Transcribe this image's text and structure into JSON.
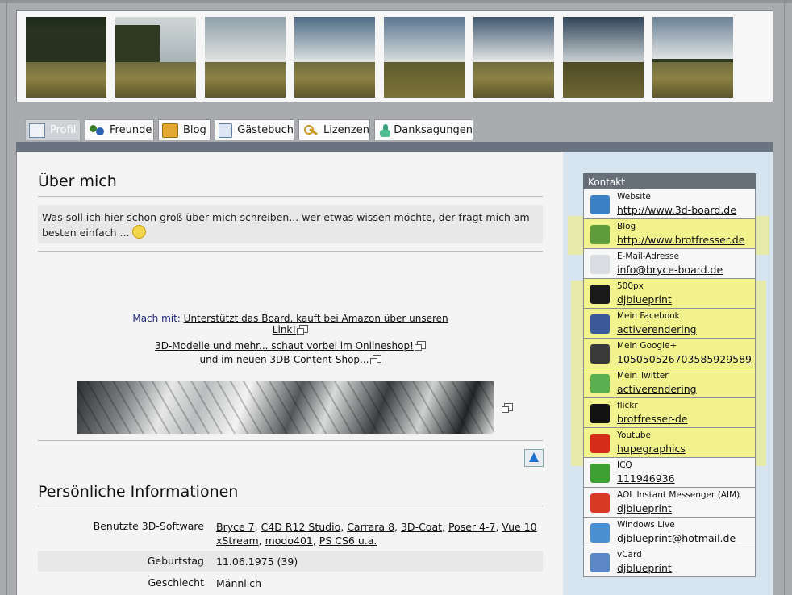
{
  "tabs": [
    {
      "label": "Profil",
      "icon": "profile-card-icon",
      "active": true
    },
    {
      "label": "Freunde",
      "icon": "friends-icon"
    },
    {
      "label": "Blog",
      "icon": "book-icon"
    },
    {
      "label": "Gästebuch",
      "icon": "guestbook-icon"
    },
    {
      "label": "Lizenzen",
      "icon": "keys-icon"
    },
    {
      "label": "Danksagungen",
      "icon": "thumbs-up-icon"
    }
  ],
  "about": {
    "heading": "Über mich",
    "text": "Was soll ich hier schon groß über mich schreiben... wer etwas wissen möchte, der fragt mich am besten einfach ..."
  },
  "promo": {
    "prefix": "Mach mit:",
    "amazon_link": "Unterstützt das Board, kauft bei Amazon über unseren Link!",
    "shop_link": "3D-Modelle und mehr... schaut vorbei im Onlineshop!",
    "content_shop_link": "und im neuen 3DB-Content-Shop..."
  },
  "personal": {
    "heading": "Persönliche Informationen",
    "software_label": "Benutzte 3D-Software",
    "software": [
      "Bryce 7",
      "C4D R12 Studio",
      "Carrara 8",
      "3D-Coat",
      "Poser 4-7",
      "Vue 10 xStream",
      "modo401",
      "PS CS6 u.a."
    ],
    "birthday_label": "Geburtstag",
    "birthday_value": "11.06.1975 (39)",
    "gender_label": "Geschlecht",
    "gender_value": "Männlich"
  },
  "kontakt": {
    "title": "Kontakt",
    "items": [
      {
        "label": "Website",
        "value": "http://www.3d-board.de",
        "icon": "house-icon",
        "color": "#3b7fc4"
      },
      {
        "label": "Blog",
        "value": "http://www.brotfresser.de",
        "icon": "house-green-icon",
        "color": "#5e9b3a"
      },
      {
        "label": "E-Mail-Adresse",
        "value": "info@bryce-board.de",
        "icon": "envelope-icon",
        "color": "#d9dde2"
      },
      {
        "label": "500px",
        "value": "djblueprint",
        "icon": "500px-icon",
        "color": "#1a1a1a"
      },
      {
        "label": "Mein Facebook",
        "value": "activerendering",
        "icon": "facebook-icon",
        "color": "#3b5998"
      },
      {
        "label": "Mein Google+",
        "value": "105050526703585929589",
        "icon": "google-plus-icon",
        "color": "#3a3a3a"
      },
      {
        "label": "Mein Twitter",
        "value": "activerendering",
        "icon": "twitter-icon",
        "color": "#5ab04f"
      },
      {
        "label": "flickr",
        "value": "brotfresser-de",
        "icon": "flickr-icon",
        "color": "#111111"
      },
      {
        "label": "Youtube",
        "value": "hupegraphics",
        "icon": "youtube-icon",
        "color": "#d62c1a"
      },
      {
        "label": "ICQ",
        "value": "111946936",
        "icon": "icq-flower-icon",
        "color": "#3da030"
      },
      {
        "label": "AOL Instant Messenger (AIM)",
        "value": "djblueprint",
        "icon": "aim-icon",
        "color": "#d63a25"
      },
      {
        "label": "Windows Live",
        "value": "djblueprint@hotmail.de",
        "icon": "windows-live-icon",
        "color": "#4a8fd0"
      },
      {
        "label": "vCard",
        "value": "djblueprint",
        "icon": "vcard-icon",
        "color": "#5b87c6"
      }
    ]
  }
}
